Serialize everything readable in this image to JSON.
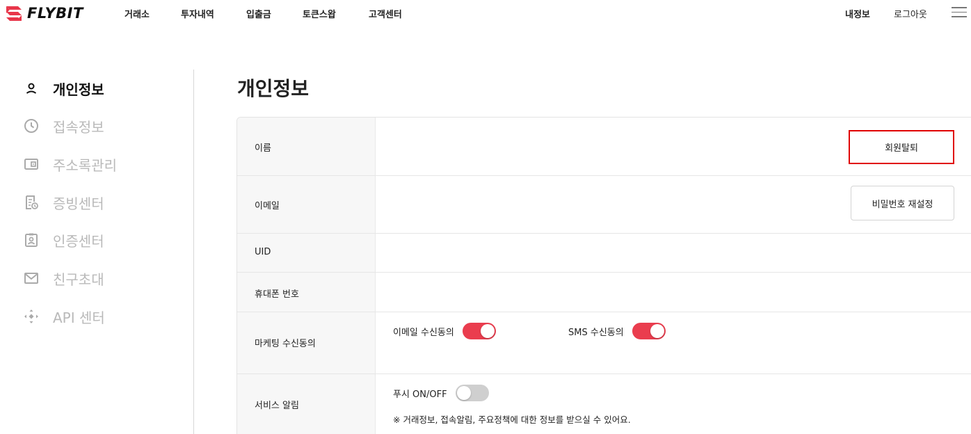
{
  "brand": {
    "name": "FLYBIT",
    "accent": "#e8364a"
  },
  "nav": {
    "items": [
      "거래소",
      "투자내역",
      "입출금",
      "토큰스왑",
      "고객센터"
    ]
  },
  "util": {
    "my_info": "내정보",
    "logout": "로그아웃",
    "menu_icon": "hamburger-icon"
  },
  "sidebar": {
    "items": [
      {
        "label": "개인정보",
        "icon": "user-icon",
        "active": true
      },
      {
        "label": "접속정보",
        "icon": "clock-icon"
      },
      {
        "label": "주소록관리",
        "icon": "wallet-icon"
      },
      {
        "label": "증빙센터",
        "icon": "document-icon"
      },
      {
        "label": "인증센터",
        "icon": "id-badge-icon"
      },
      {
        "label": "친구초대",
        "icon": "mail-icon"
      },
      {
        "label": "API 센터",
        "icon": "api-icon"
      }
    ]
  },
  "main": {
    "title": "개인정보",
    "rows": {
      "name": "이름",
      "email": "이메일",
      "uid": "UID",
      "phone": "휴대폰 번호",
      "marketing": "마케팅 수신동의",
      "service": "서비스 알림"
    },
    "buttons": {
      "withdraw": "회원탈퇴",
      "reset_password": "비밀번호 재설정"
    },
    "marketing": {
      "email_label": "이메일 수신동의",
      "email_on": true,
      "sms_label": "SMS 수신동의",
      "sms_on": true
    },
    "service": {
      "push_label": "푸시 ON/OFF",
      "push_on": false,
      "note": "※ 거래정보, 접속알림, 주요정책에 대한 정보를 받으실 수 있어요."
    }
  }
}
